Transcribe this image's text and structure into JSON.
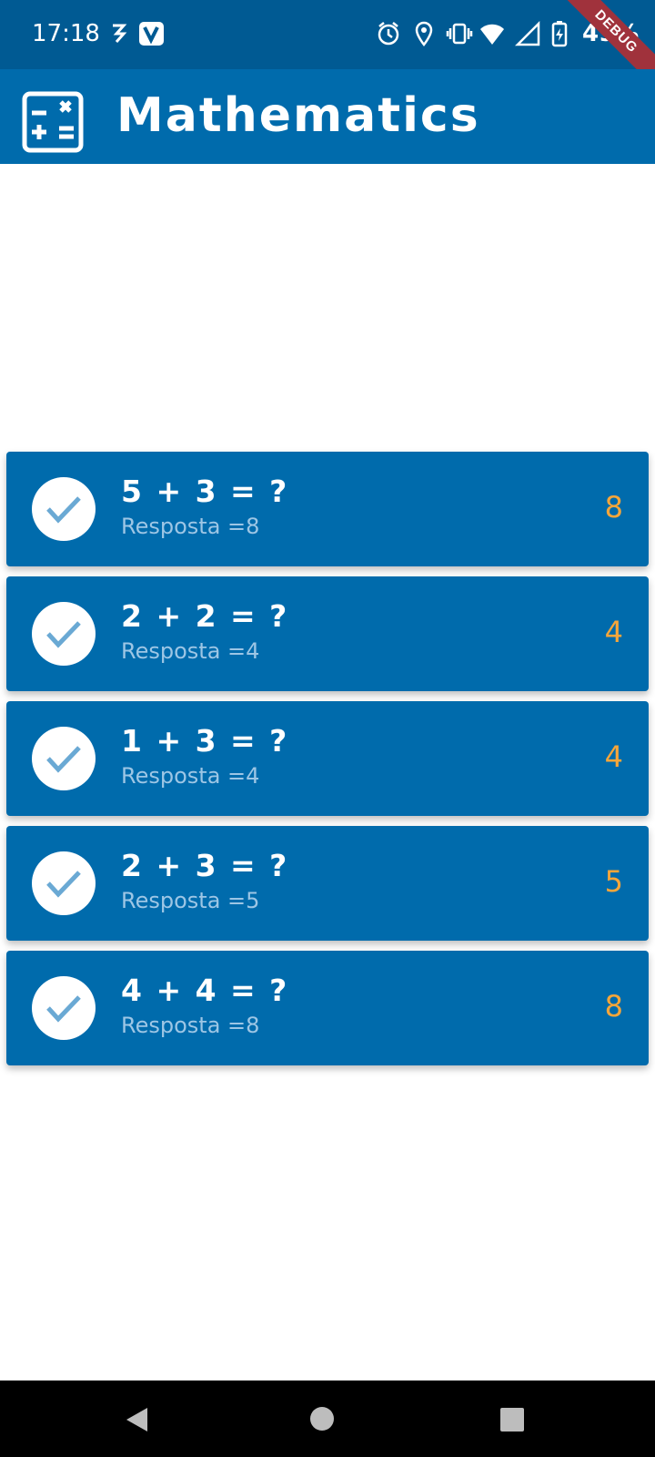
{
  "status": {
    "time": "17:18",
    "battery": "49%",
    "debug_label": "DEBUG",
    "icons": [
      "s-notification-icon",
      "v-app-icon",
      "alarm-icon",
      "location-icon",
      "vibrate-icon",
      "wifi-icon",
      "signal-icon",
      "battery-charging-icon"
    ]
  },
  "app_bar": {
    "title": "Mathematics",
    "logo_icon": "calculator-icon",
    "color": "#006bac"
  },
  "questions": [
    {
      "question": "5 + 3 = ?",
      "subtitle": "Resposta =8",
      "answer": "8"
    },
    {
      "question": "2 + 2 = ?",
      "subtitle": "Resposta =4",
      "answer": "4"
    },
    {
      "question": "1 + 3 = ?",
      "subtitle": "Resposta =4",
      "answer": "4"
    },
    {
      "question": "2 + 3 = ?",
      "subtitle": "Resposta =5",
      "answer": "5"
    },
    {
      "question": "4 + 4 = ?",
      "subtitle": "Resposta =8",
      "answer": "8"
    }
  ],
  "colors": {
    "primary": "#006bac",
    "status_bar": "#005a93",
    "answer": "#f6a63a",
    "subtitle": "#9dc6e5",
    "check": "#6aa9d4"
  },
  "nav": {
    "buttons": [
      "back-icon",
      "home-icon",
      "recents-icon"
    ]
  }
}
